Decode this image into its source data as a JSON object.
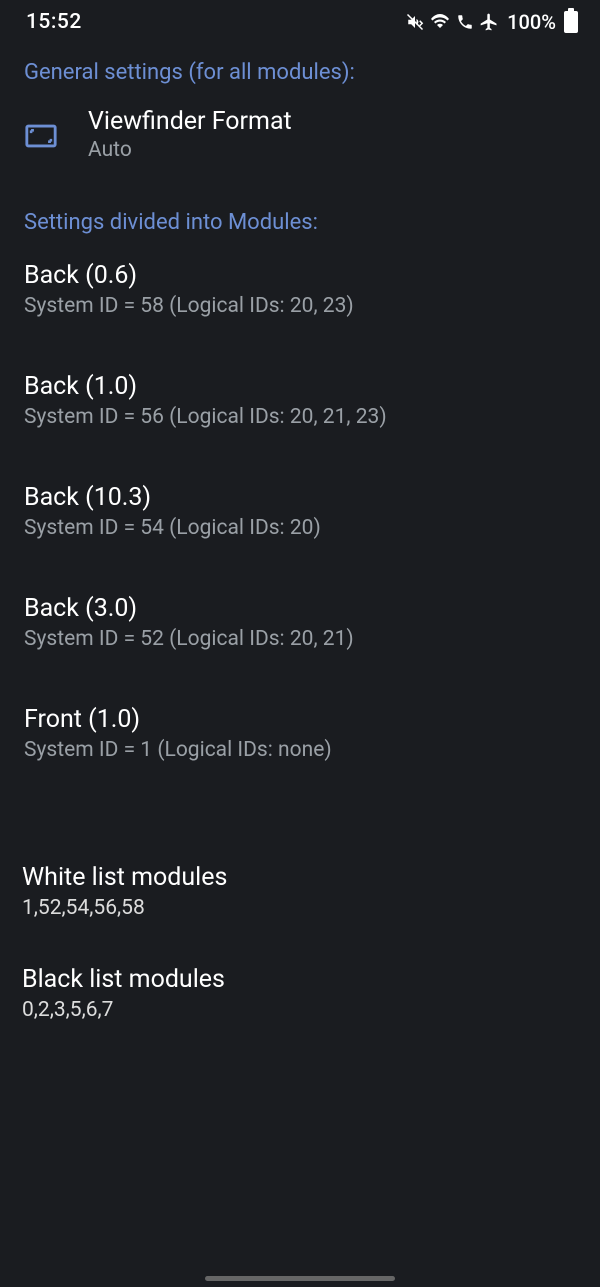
{
  "status_bar": {
    "time": "15:52",
    "battery_percent": "100%"
  },
  "sections": {
    "general_header": "General settings (for all modules):",
    "modules_header": "Settings divided into Modules:"
  },
  "viewfinder": {
    "title": "Viewfinder Format",
    "value": "Auto"
  },
  "modules": [
    {
      "title": "Back  (0.6)",
      "subtitle": "System ID = 58  (Logical IDs:  20, 23)"
    },
    {
      "title": "Back  (1.0)",
      "subtitle": "System ID = 56  (Logical IDs:  20, 21, 23)"
    },
    {
      "title": "Back  (10.3)",
      "subtitle": "System ID = 54  (Logical IDs:  20)"
    },
    {
      "title": "Back  (3.0)",
      "subtitle": "System ID = 52  (Logical IDs:  20, 21)"
    },
    {
      "title": "Front  (1.0)",
      "subtitle": "System ID = 1  (Logical IDs:  none)"
    }
  ],
  "whitelist": {
    "title": "White list modules",
    "value": "1,52,54,56,58"
  },
  "blacklist": {
    "title": "Black list modules",
    "value": "0,2,3,5,6,7"
  }
}
